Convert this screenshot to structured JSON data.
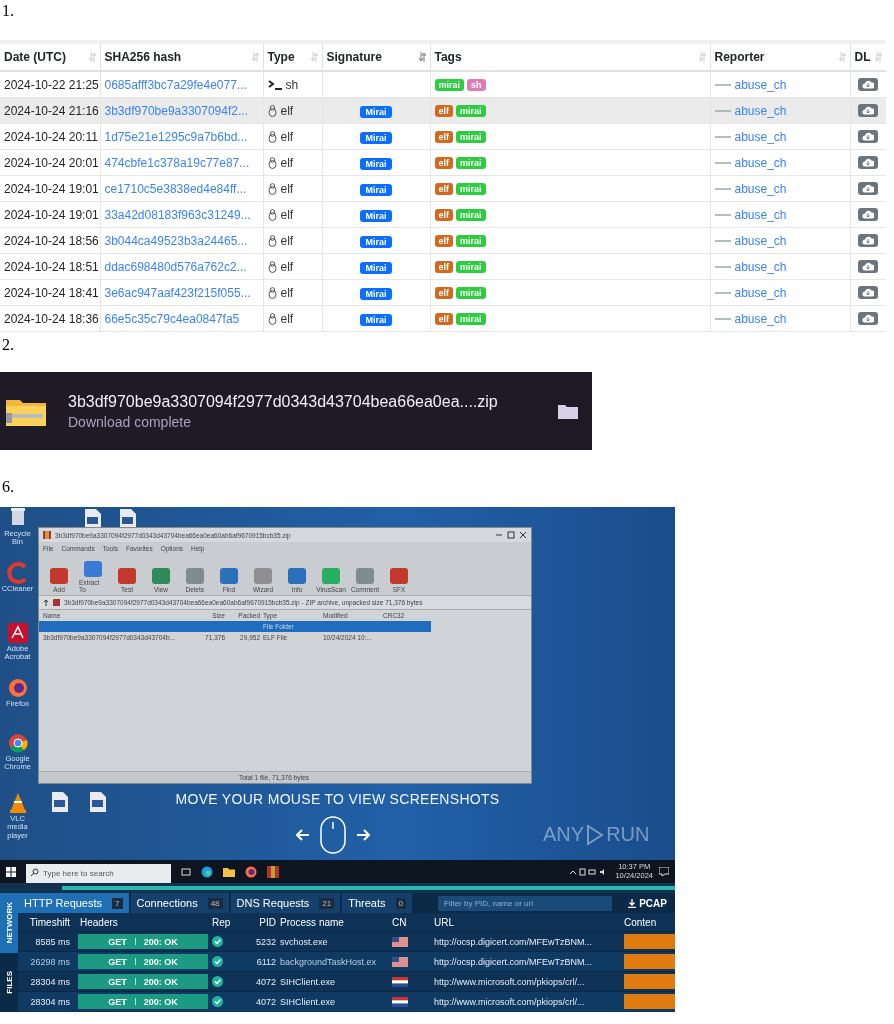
{
  "malware_table": {
    "label": "1.",
    "columns": [
      "Date (UTC)",
      "SHA256 hash",
      "Type",
      "Signature",
      "Tags",
      "Reporter",
      "DL"
    ],
    "rows": [
      {
        "date": "2024-10-22 21:25",
        "hash": "0685afff3bc7a29fe4e077...",
        "type": "sh",
        "kind": "shell",
        "tags": [
          {
            "text": "mirai",
            "color": "#2ecc40"
          },
          {
            "text": "sh",
            "color": "#e07bb5"
          }
        ],
        "reporter": "abuse_ch",
        "selected": false
      },
      {
        "date": "2024-10-24 21:16",
        "hash": "3b3df970be9a3307094f2...",
        "type": "elf",
        "kind": "linux",
        "signature": "Mirai",
        "tags": [
          {
            "text": "elf",
            "color": "#d2691e"
          },
          {
            "text": "mirai",
            "color": "#2ecc40"
          }
        ],
        "reporter": "abuse_ch",
        "selected": true
      },
      {
        "date": "2024-10-24 20:11",
        "hash": "1d75e21e1295c9a7b6bd...",
        "type": "elf",
        "kind": "linux",
        "signature": "Mirai",
        "tags": [
          {
            "text": "elf",
            "color": "#d2691e"
          },
          {
            "text": "mirai",
            "color": "#2ecc40"
          }
        ],
        "reporter": "abuse_ch",
        "selected": false
      },
      {
        "date": "2024-10-24 20:01",
        "hash": "474cbfe1c378a19c77e87...",
        "type": "elf",
        "kind": "linux",
        "signature": "Mirai",
        "tags": [
          {
            "text": "elf",
            "color": "#d2691e"
          },
          {
            "text": "mirai",
            "color": "#2ecc40"
          }
        ],
        "reporter": "abuse_ch",
        "selected": false
      },
      {
        "date": "2024-10-24 19:01",
        "hash": "ce1710c5e3838ed4e84ff...",
        "type": "elf",
        "kind": "linux",
        "signature": "Mirai",
        "tags": [
          {
            "text": "elf",
            "color": "#d2691e"
          },
          {
            "text": "mirai",
            "color": "#2ecc40"
          }
        ],
        "reporter": "abuse_ch",
        "selected": false
      },
      {
        "date": "2024-10-24 19:01",
        "hash": "33a42d08183f963c31249...",
        "type": "elf",
        "kind": "linux",
        "signature": "Mirai",
        "tags": [
          {
            "text": "elf",
            "color": "#d2691e"
          },
          {
            "text": "mirai",
            "color": "#2ecc40"
          }
        ],
        "reporter": "abuse_ch",
        "selected": false
      },
      {
        "date": "2024-10-24 18:56",
        "hash": "3b044ca49523b3a24465...",
        "type": "elf",
        "kind": "linux",
        "signature": "Mirai",
        "tags": [
          {
            "text": "elf",
            "color": "#d2691e"
          },
          {
            "text": "mirai",
            "color": "#2ecc40"
          }
        ],
        "reporter": "abuse_ch",
        "selected": false
      },
      {
        "date": "2024-10-24 18:51",
        "hash": "ddac698480d576a762c2...",
        "type": "elf",
        "kind": "linux",
        "signature": "Mirai",
        "tags": [
          {
            "text": "elf",
            "color": "#d2691e"
          },
          {
            "text": "mirai",
            "color": "#2ecc40"
          }
        ],
        "reporter": "abuse_ch",
        "selected": false
      },
      {
        "date": "2024-10-24 18:41",
        "hash": "3e6ac947aaf423f215f055...",
        "type": "elf",
        "kind": "linux",
        "signature": "Mirai",
        "tags": [
          {
            "text": "elf",
            "color": "#d2691e"
          },
          {
            "text": "mirai",
            "color": "#2ecc40"
          }
        ],
        "reporter": "abuse_ch",
        "selected": false
      },
      {
        "date": "2024-10-24 18:36",
        "hash": "66e5c35c79c4ea0847fa5",
        "type": "elf",
        "kind": "linux",
        "signature": "Mirai",
        "tags": [
          {
            "text": "elf",
            "color": "#d2691e"
          },
          {
            "text": "mirai",
            "color": "#2ecc40"
          }
        ],
        "reporter": "abuse_ch",
        "selected": false
      }
    ]
  },
  "download": {
    "label": "2.",
    "filename": "3b3df970be9a3307094f2977d0343d43704bea66ea0ea....zip",
    "status": "Download complete"
  },
  "sandbox": {
    "label": "6.",
    "desktop_icons": [
      {
        "label": "Recycle Bin",
        "kind": "bin"
      },
      {
        "label": "CCleaner",
        "kind": "ccleaner"
      },
      {
        "label": "Adobe Acrobat",
        "kind": "acrobat"
      },
      {
        "label": "Firefox",
        "kind": "firefox"
      },
      {
        "label": "Google Chrome",
        "kind": "chrome"
      },
      {
        "label": "VLC media player",
        "kind": "vlc"
      }
    ],
    "archiver": {
      "title": "3b3df970be9a3307094f2977d0343d43704bea66ea0ea60ab6af9670915bcb35.zip",
      "menu": [
        "File",
        "Commands",
        "Tools",
        "Favorites",
        "Options",
        "Help"
      ],
      "tools": [
        {
          "label": "Add",
          "color": "#c0392b"
        },
        {
          "label": "Extract To",
          "color": "#3a7bd5"
        },
        {
          "label": "Test",
          "color": "#c0392b"
        },
        {
          "label": "View",
          "color": "#2e8b57"
        },
        {
          "label": "Delete",
          "color": "#7f8c8d"
        },
        {
          "label": "Find",
          "color": "#2c6fbb"
        },
        {
          "label": "Wizard",
          "color": "#8e8e8e"
        },
        {
          "label": "Info",
          "color": "#2c6fbb"
        },
        {
          "label": "VirusScan",
          "color": "#27ae60"
        },
        {
          "label": "Comment",
          "color": "#7f8c8d"
        },
        {
          "label": "SFX",
          "color": "#c0392b"
        }
      ],
      "path": "3b3df970be9a3307094f2977d0343d43704bea66ea0ea60ab6af9670915bcb35.zip - ZIP archive, unpacked size 71,376 bytes",
      "columns": [
        "Name",
        "Size",
        "Packed",
        "Type",
        "Modified",
        "CRC32"
      ],
      "rows": [
        {
          "type": "File Folder",
          "selected": true
        },
        {
          "name": "3b3df970be9a3307094f2977d0343d43704b...",
          "size": "71,376",
          "packed": "29,952",
          "type": "ELF File",
          "modified": "10/24/2024 10:...",
          "selected": false
        }
      ],
      "status": "Total 1 file, 71,376 bytes"
    },
    "hint": "MOVE YOUR MOUSE TO VIEW SCREENSHOTS",
    "logo": [
      "ANY",
      "RUN"
    ],
    "taskbar": {
      "search_placeholder": "Type here to search",
      "time": "10:37 PM",
      "date": "10/24/2024"
    },
    "tabs": [
      {
        "label": "HTTP Requests",
        "count": "7",
        "selected": true
      },
      {
        "label": "Connections",
        "count": "48",
        "selected": false
      },
      {
        "label": "DNS Requests",
        "count": "21",
        "selected": false
      },
      {
        "label": "Threats",
        "count": "0",
        "selected": false
      }
    ],
    "filter_placeholder": "Filter by PID, name or url",
    "pcap": "PCAP",
    "side_tabs": [
      {
        "label": "NETWORK",
        "selected": true
      },
      {
        "label": "FILES",
        "selected": false
      }
    ],
    "columns": [
      "Timeshift",
      "Headers",
      "Rep",
      "PID",
      "Process name",
      "CN",
      "URL",
      "Conten"
    ],
    "requests": [
      {
        "timeshift": "8585 ms",
        "method": "GET",
        "status": "200: OK",
        "pid": "5232",
        "process": "svchost.exe",
        "kind": "us",
        "url": "http://ocsp.digicert.com/MFEwTzBNM..."
      },
      {
        "timeshift": "26298 ms",
        "method": "GET",
        "status": "200: OK",
        "pid": "6112",
        "process": "backgroundTaskHost.ex",
        "kind": "us",
        "url": "http://ocsp.digicert.com/MFEwTzBNM..."
      },
      {
        "timeshift": "28304 ms",
        "method": "GET",
        "status": "200: OK",
        "pid": "4072",
        "process": "SIHClient.exe",
        "kind": "nl",
        "url": "http://www.microsoft.com/pkiops/crl/..."
      },
      {
        "timeshift": "28304 ms",
        "method": "GET",
        "status": "200: OK",
        "pid": "4072",
        "process": "SIHClient.exe",
        "kind": "nl",
        "url": "http://www.microsoft.com/pkiops/crl/..."
      }
    ]
  }
}
